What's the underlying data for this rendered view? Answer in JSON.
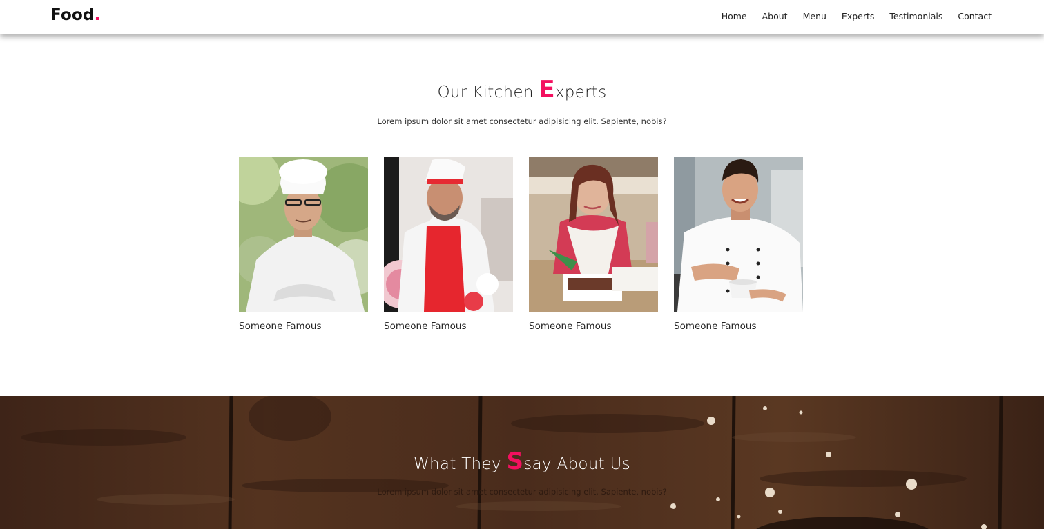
{
  "brand": {
    "name": "Food",
    "dot": "."
  },
  "nav": {
    "items": [
      {
        "label": "Home"
      },
      {
        "label": "About"
      },
      {
        "label": "Menu"
      },
      {
        "label": "Experts"
      },
      {
        "label": "Testimonials"
      },
      {
        "label": "Contact"
      }
    ]
  },
  "experts": {
    "title_before": "Our Kitchen ",
    "title_accent": "E",
    "title_after": "xperts",
    "subtitle": "Lorem ipsum dolor sit amet consectetur adipisicing elit. Sapiente, nobis?",
    "cards": [
      {
        "name": "Someone Famous"
      },
      {
        "name": "Someone Famous"
      },
      {
        "name": "Someone Famous"
      },
      {
        "name": "Someone Famous"
      }
    ]
  },
  "testimonials": {
    "title_before": "What They ",
    "title_accent": "S",
    "title_after": "say About Us",
    "subtitle": "Lorem ipsum dolor sit amet consectetur adipisicing elit. Sapiente, nobis?"
  },
  "colors": {
    "accent": "#f3105f",
    "wood": "#4a2a1a"
  }
}
